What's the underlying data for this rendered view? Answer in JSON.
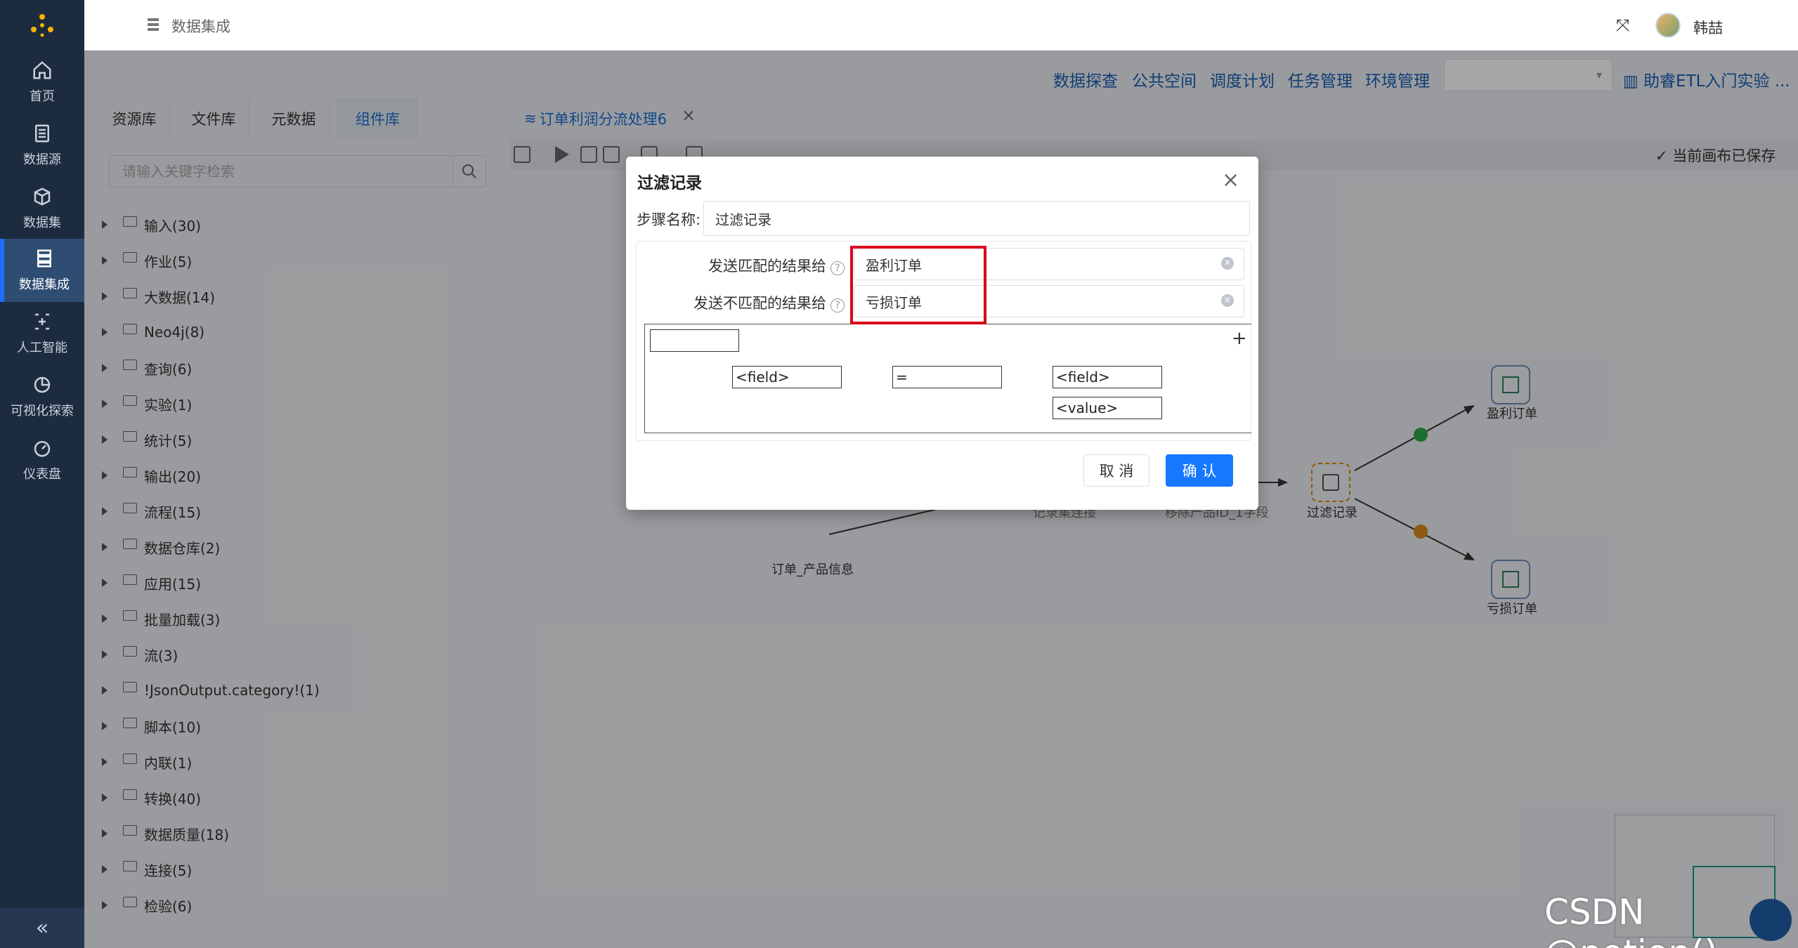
{
  "app": {
    "title": "数据集成",
    "user": "韩喆"
  },
  "sidebar": {
    "items": [
      {
        "label": "首页",
        "icon": "home-icon"
      },
      {
        "label": "数据源",
        "icon": "datasource-icon"
      },
      {
        "label": "数据集",
        "icon": "dataset-icon"
      },
      {
        "label": "数据集成",
        "icon": "integration-icon",
        "active": true
      },
      {
        "label": "人工智能",
        "icon": "ai-icon"
      },
      {
        "label": "可视化探索",
        "icon": "chart-pie-icon"
      },
      {
        "label": "仪表盘",
        "icon": "dashboard-icon"
      }
    ],
    "collapse": "«"
  },
  "toplinks": [
    "数据探查",
    "公共空间",
    "调度计划",
    "任务管理",
    "环境管理"
  ],
  "help_link": "助睿ETL入门实验 ...",
  "panel": {
    "tabs": [
      "资源库",
      "文件库",
      "元数据",
      "组件库"
    ],
    "active_tab": "组件库",
    "search_placeholder": "请输入关键字检索",
    "tree": [
      "输入(30)",
      "作业(5)",
      "大数据(14)",
      "Neo4j(8)",
      "查询(6)",
      "实验(1)",
      "统计(5)",
      "输出(20)",
      "流程(15)",
      "数据仓库(2)",
      "应用(15)",
      "批量加载(3)",
      "流(3)",
      "!JsonOutput.category!(1)",
      "脚本(10)",
      "内联(1)",
      "转换(40)",
      "数据质量(18)",
      "连接(5)",
      "检验(6)"
    ]
  },
  "editor": {
    "tab": "订单利润分流处理6",
    "saved": "当前画布已保存",
    "nodes": {
      "order_product": "订单_产品信息",
      "join": "记录集连接",
      "remove": "移除产品ID_1字段",
      "filter": "过滤记录",
      "profit": "盈利订单",
      "loss": "亏损订单"
    }
  },
  "dialog": {
    "title": "过滤记录",
    "step_name_label": "步骤名称:",
    "step_name": "过滤记录",
    "match_label": "发送匹配的结果给",
    "match_value": "盈利订单",
    "nomatch_label": "发送不匹配的结果给",
    "nomatch_value": "亏损订单",
    "cond_field1": "<field>",
    "cond_op": "=",
    "cond_field2": "<field>",
    "cond_value": "<value>",
    "cancel": "取 消",
    "confirm": "确 认"
  },
  "watermark": "CSDN @potion()",
  "colors": {
    "sidebar": "#1d2b3f",
    "accent": "#1e6fff",
    "highlight": "#d9001b"
  }
}
